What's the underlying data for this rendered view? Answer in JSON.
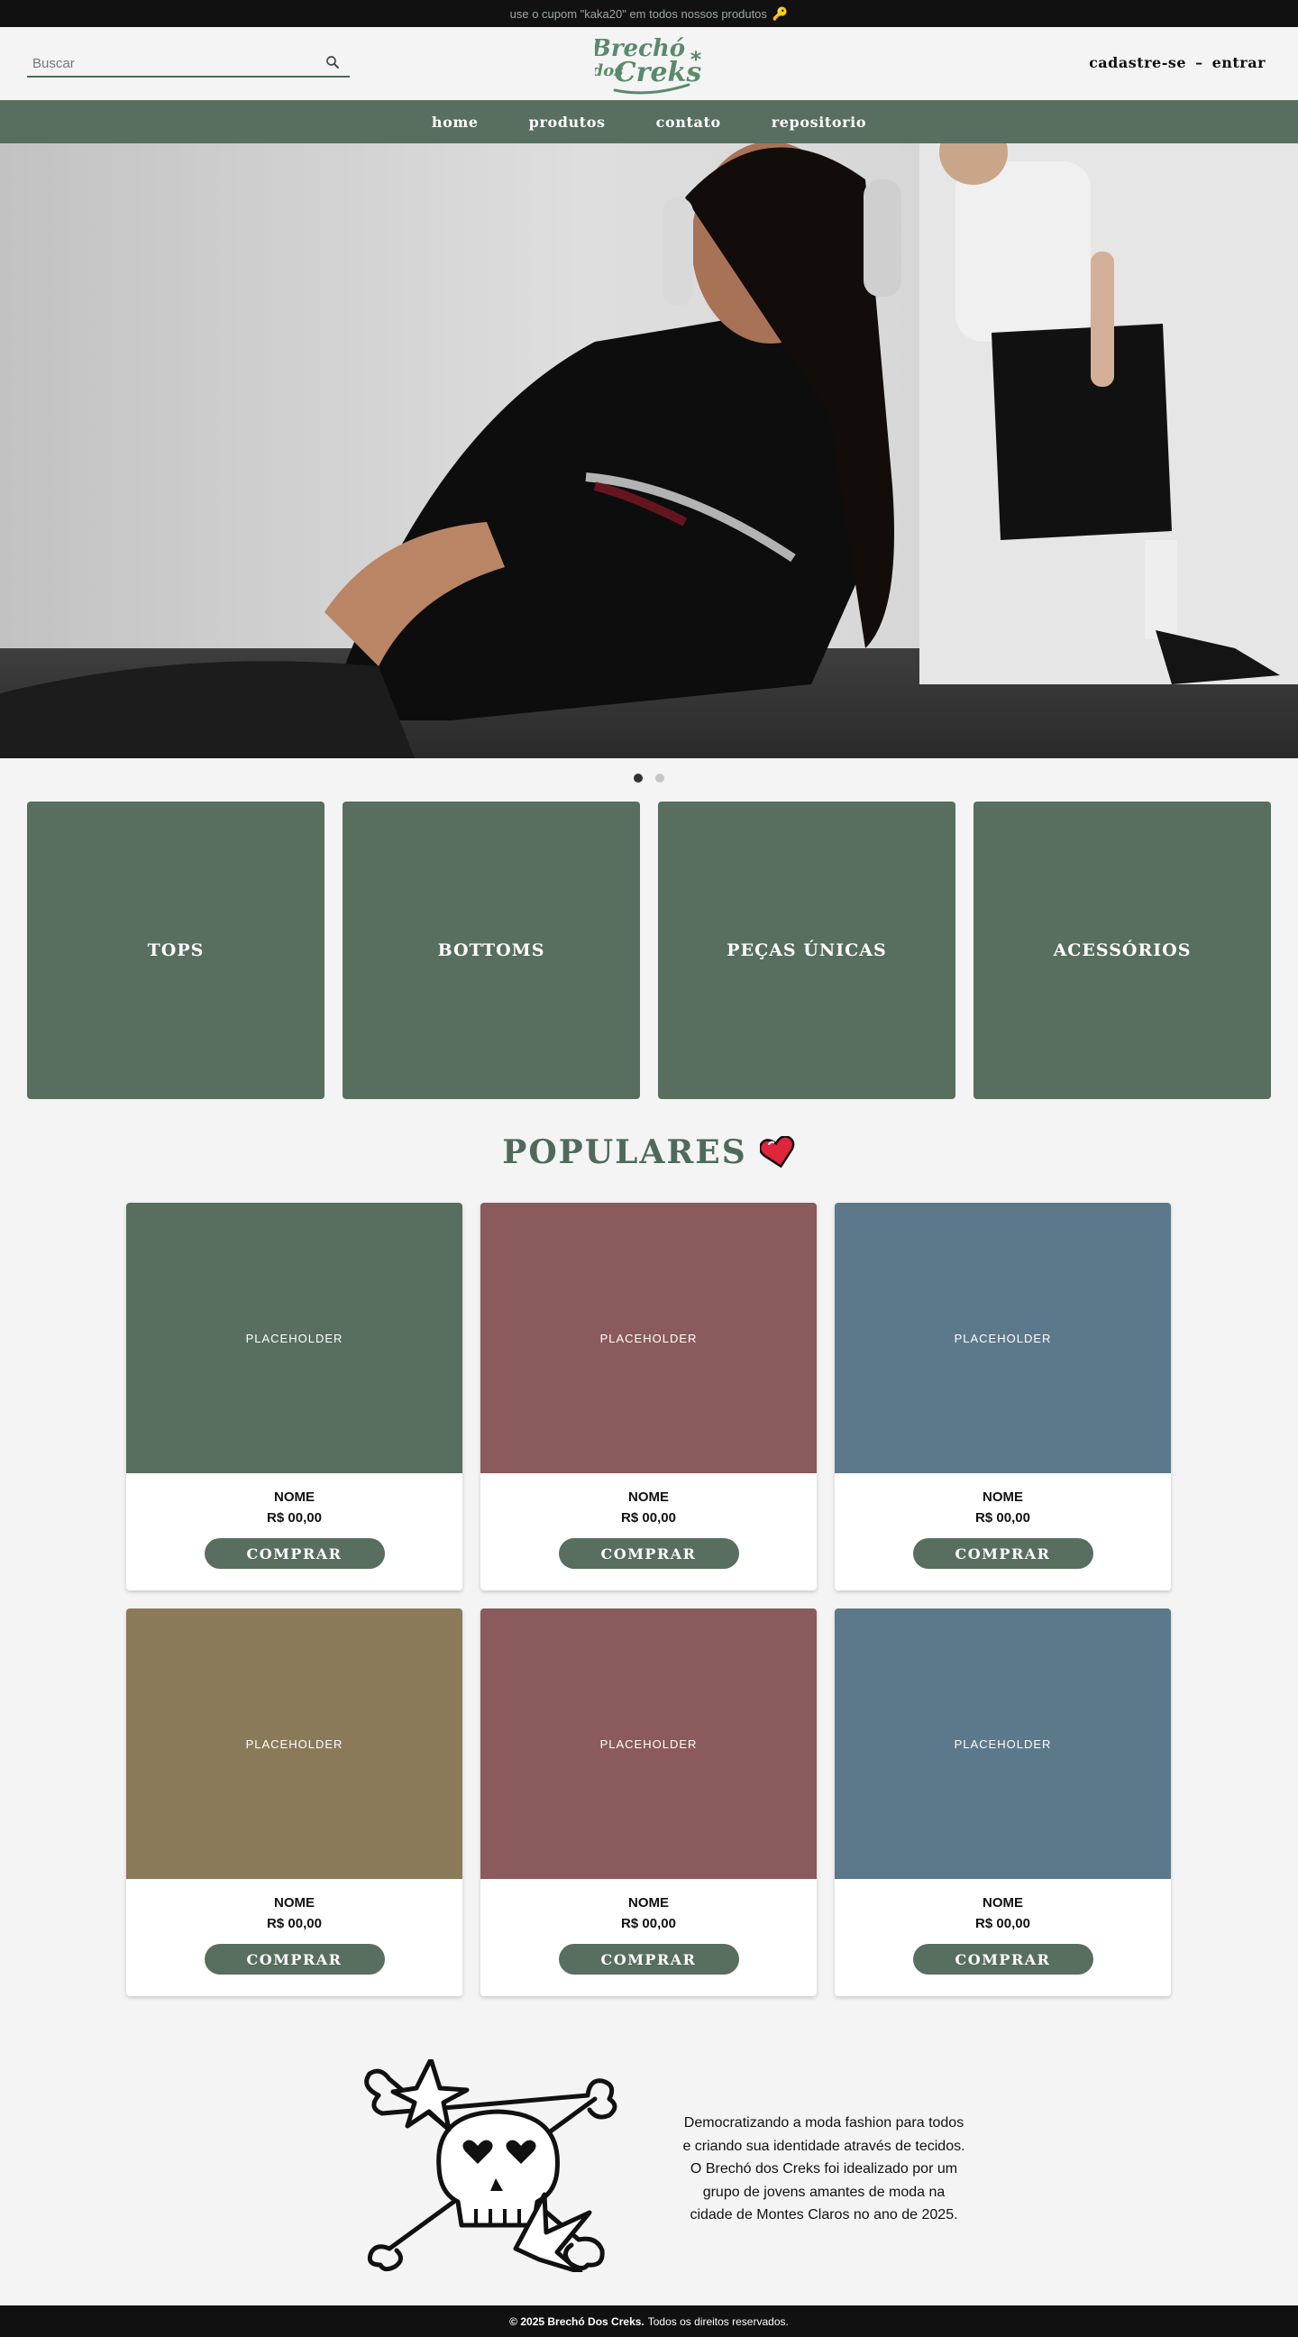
{
  "promo": {
    "text": "use o cupom \"kaka20\" em todos nossos produtos",
    "icon": "key-icon"
  },
  "header": {
    "search_placeholder": "Buscar",
    "logo_line1": "Brechó",
    "logo_line2": "dos",
    "logo_line3": "Creks",
    "logo_mark": "*",
    "signup": "cadastre-se",
    "separator": "–",
    "login": "entrar"
  },
  "nav": {
    "items": [
      "home",
      "produtos",
      "contato",
      "repositorio"
    ]
  },
  "hero": {
    "slides": 2,
    "active_slide": 1
  },
  "categories": [
    "TOPS",
    "BOTTOMS",
    "PEÇAS ÚNICAS",
    "ACESSÓRIOS"
  ],
  "populares": {
    "title": "POPULARES",
    "products": [
      {
        "image_label": "PLACEHOLDER",
        "name": "NOME",
        "price": "R$ 00,00",
        "button": "COMPRAR",
        "color": "#586e5e"
      },
      {
        "image_label": "PLACEHOLDER",
        "name": "NOME",
        "price": "R$ 00,00",
        "button": "COMPRAR",
        "color": "#8b5a5c"
      },
      {
        "image_label": "PLACEHOLDER",
        "name": "NOME",
        "price": "R$ 00,00",
        "button": "COMPRAR",
        "color": "#5c788b"
      },
      {
        "image_label": "PLACEHOLDER",
        "name": "NOME",
        "price": "R$ 00,00",
        "button": "COMPRAR",
        "color": "#8b7a5a"
      },
      {
        "image_label": "PLACEHOLDER",
        "name": "NOME",
        "price": "R$ 00,00",
        "button": "COMPRAR",
        "color": "#8b5a5c"
      },
      {
        "image_label": "PLACEHOLDER",
        "name": "NOME",
        "price": "R$ 00,00",
        "button": "COMPRAR",
        "color": "#5c788b"
      }
    ]
  },
  "about": {
    "text": "Democratizando a moda fashion para todos e criando sua identidade através de tecidos. O Brechó dos Creks foi idealizado por um grupo de jovens amantes de moda na cidade de Montes Claros no ano de 2025."
  },
  "footer": {
    "brand": "© 2025 Brechó Dos Creks.",
    "rights": "Todos os direitos reservados."
  },
  "colors": {
    "accent": "#586e5e",
    "dark": "#111111",
    "background": "#f4f4f4"
  }
}
